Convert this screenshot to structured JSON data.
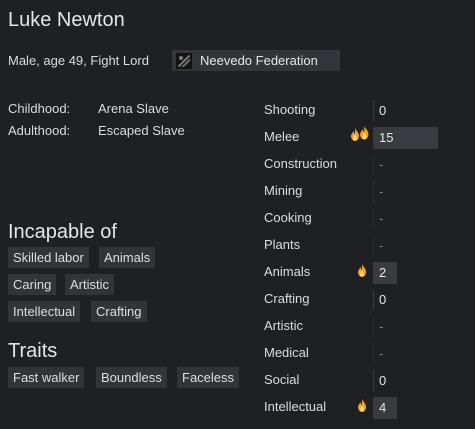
{
  "pawn": {
    "name": "Luke Newton",
    "description": "Male, age 49, Fight Lord",
    "faction": "Neevedo Federation",
    "faction_icon": "faction-emblem-icon"
  },
  "backstory": [
    {
      "label": "Childhood:",
      "value": "Arena Slave"
    },
    {
      "label": "Adulthood:",
      "value": "Escaped Slave"
    }
  ],
  "incapable": {
    "title": "Incapable of",
    "tags": [
      "Skilled labor",
      "Animals",
      "Caring",
      "Artistic",
      "Intellectual",
      "Crafting"
    ]
  },
  "traits": {
    "title": "Traits",
    "tags": [
      "Fast walker",
      "Boundless",
      "Faceless"
    ]
  },
  "skills": [
    {
      "name": "Shooting",
      "level": "0",
      "passion": "none"
    },
    {
      "name": "Melee",
      "level": "15",
      "passion": "major",
      "bar_fraction": 0.75
    },
    {
      "name": "Construction",
      "level": "-",
      "passion": "none"
    },
    {
      "name": "Mining",
      "level": "-",
      "passion": "none"
    },
    {
      "name": "Cooking",
      "level": "-",
      "passion": "none"
    },
    {
      "name": "Plants",
      "level": "-",
      "passion": "none"
    },
    {
      "name": "Animals",
      "level": "2",
      "passion": "minor",
      "bar_fraction": 0.1
    },
    {
      "name": "Crafting",
      "level": "0",
      "passion": "none"
    },
    {
      "name": "Artistic",
      "level": "-",
      "passion": "none"
    },
    {
      "name": "Medical",
      "level": "-",
      "passion": "none"
    },
    {
      "name": "Social",
      "level": "0",
      "passion": "none"
    },
    {
      "name": "Intellectual",
      "level": "4",
      "passion": "minor",
      "bar_fraction": 0.2
    }
  ],
  "colors": {
    "background": "#1f2024",
    "tag_bg": "#33343a",
    "skill_bar": "#3a3b40",
    "passion_flame": "#f0a024"
  }
}
